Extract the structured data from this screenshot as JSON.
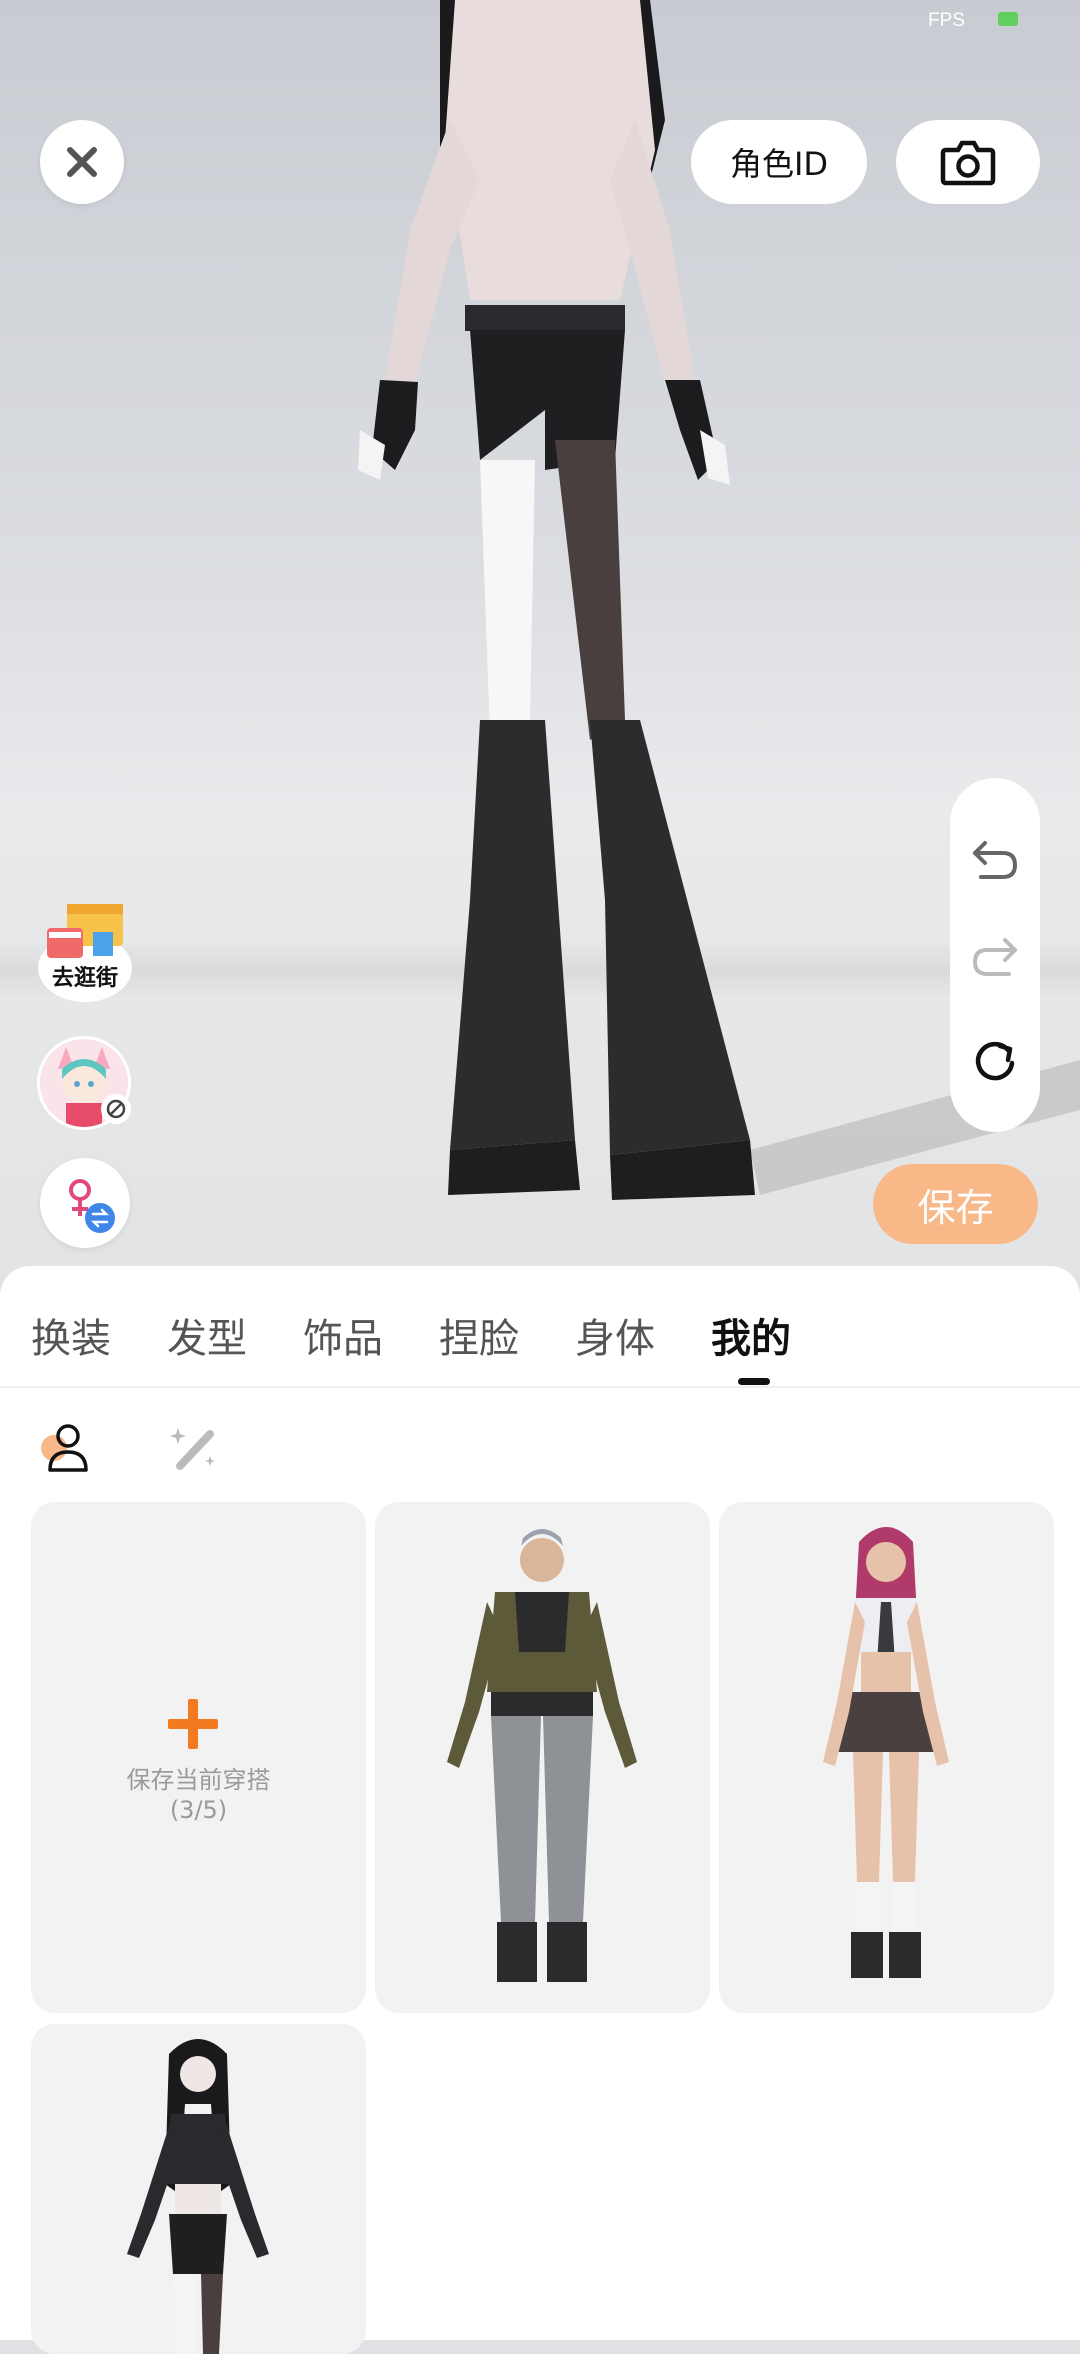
{
  "status": {
    "fps_label": "FPS"
  },
  "top": {
    "close_icon": "close-icon",
    "role_id_label": "角色ID",
    "camera_icon": "camera-icon"
  },
  "side_buttons": {
    "shop_label": "去逛街",
    "avatar_icon": "avatar-icon",
    "gender_icon": "gender-switch-icon"
  },
  "history": {
    "undo_icon": "undo-icon",
    "redo_icon": "redo-icon",
    "reset_icon": "reset-icon"
  },
  "save_label": "保存",
  "tabs": [
    {
      "label": "换装"
    },
    {
      "label": "发型"
    },
    {
      "label": "饰品"
    },
    {
      "label": "捏脸"
    },
    {
      "label": "身体"
    },
    {
      "label": "我的",
      "active": true
    }
  ],
  "subtabs": [
    {
      "icon": "person-icon"
    },
    {
      "icon": "magic-wand-icon"
    }
  ],
  "outfits": {
    "add_label": "保存当前穿搭",
    "count_label": "(3/5)",
    "items": [
      {
        "name": "male-outfit"
      },
      {
        "name": "female-outfit"
      },
      {
        "name": "goth-outfit"
      }
    ]
  },
  "colors": {
    "accent": "#f47a1f",
    "save_bg": "#f9b888",
    "active_tab": "#111111"
  }
}
